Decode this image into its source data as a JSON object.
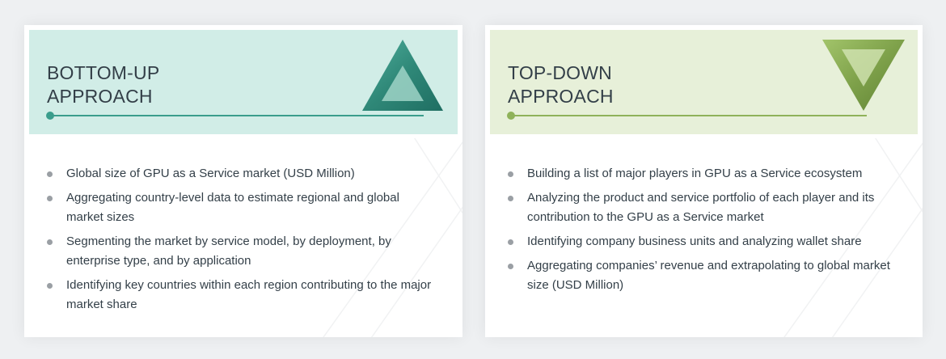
{
  "bottom_up": {
    "title": "BOTTOM-UP\nAPPROACH",
    "accent": "#3a9d8c",
    "header_bg": "#d1ede7",
    "icon": "upward-triangle-icon",
    "items": [
      "Global size of GPU as a Service market (USD Million)",
      "Aggregating country-level data to estimate regional and global market sizes",
      "Segmenting the market by service model, by deployment, by enterprise type, and by application",
      "Identifying key countries within each region contributing to the major market share"
    ]
  },
  "top_down": {
    "title": "TOP-DOWN\nAPPROACH",
    "accent": "#8fb25a",
    "header_bg": "#e7f0d9",
    "icon": "downward-triangle-icon",
    "items": [
      "Building a list of major players in GPU as a Service ecosystem",
      "Analyzing the product and service portfolio of each player and its contribution to the GPU as a Service market",
      "Identifying company business units and analyzing wallet share",
      "Aggregating companies’ revenue and extrapolating to global market size (USD Million)"
    ]
  }
}
